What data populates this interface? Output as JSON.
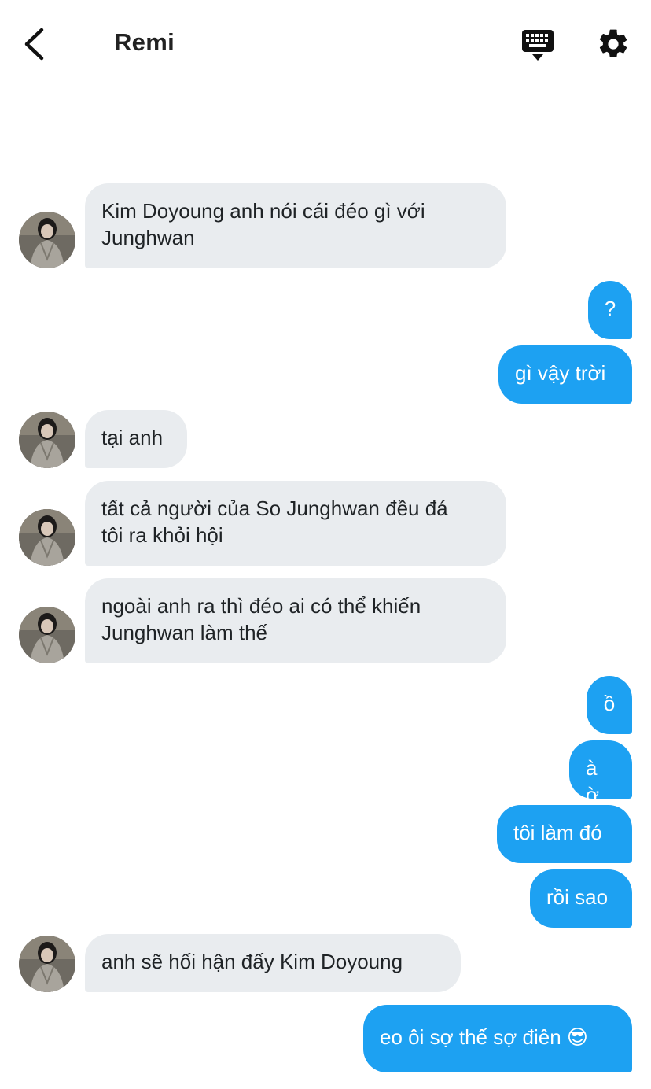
{
  "header": {
    "title": "Remi",
    "back_icon": "chevron-left-icon",
    "keyboard_icon": "keyboard-icon",
    "settings_icon": "gear-icon"
  },
  "colors": {
    "outgoing_bubble": "#1da1f2",
    "incoming_bubble": "#e9ecef"
  },
  "messages": [
    {
      "from": "them",
      "text": "Kim Doyoung anh nói cái đéo gì với\nJunghwan"
    },
    {
      "from": "me",
      "text": "?"
    },
    {
      "from": "me",
      "text": "gì vậy trời"
    },
    {
      "from": "them",
      "text": "tại anh"
    },
    {
      "from": "them",
      "text": "tất cả người của So Junghwan đều đá\ntôi ra khỏi hội"
    },
    {
      "from": "them",
      "text": "ngoài anh ra thì đéo ai có thể khiến\nJunghwan làm thế"
    },
    {
      "from": "me",
      "text": "ồ"
    },
    {
      "from": "me",
      "text": "à ờ"
    },
    {
      "from": "me",
      "text": "tôi làm đó"
    },
    {
      "from": "me",
      "text": "rồi sao"
    },
    {
      "from": "them",
      "text": "anh sẽ hối hận đấy Kim Doyoung"
    },
    {
      "from": "me",
      "text": "eo ôi sợ thế sợ điên 😎"
    }
  ]
}
